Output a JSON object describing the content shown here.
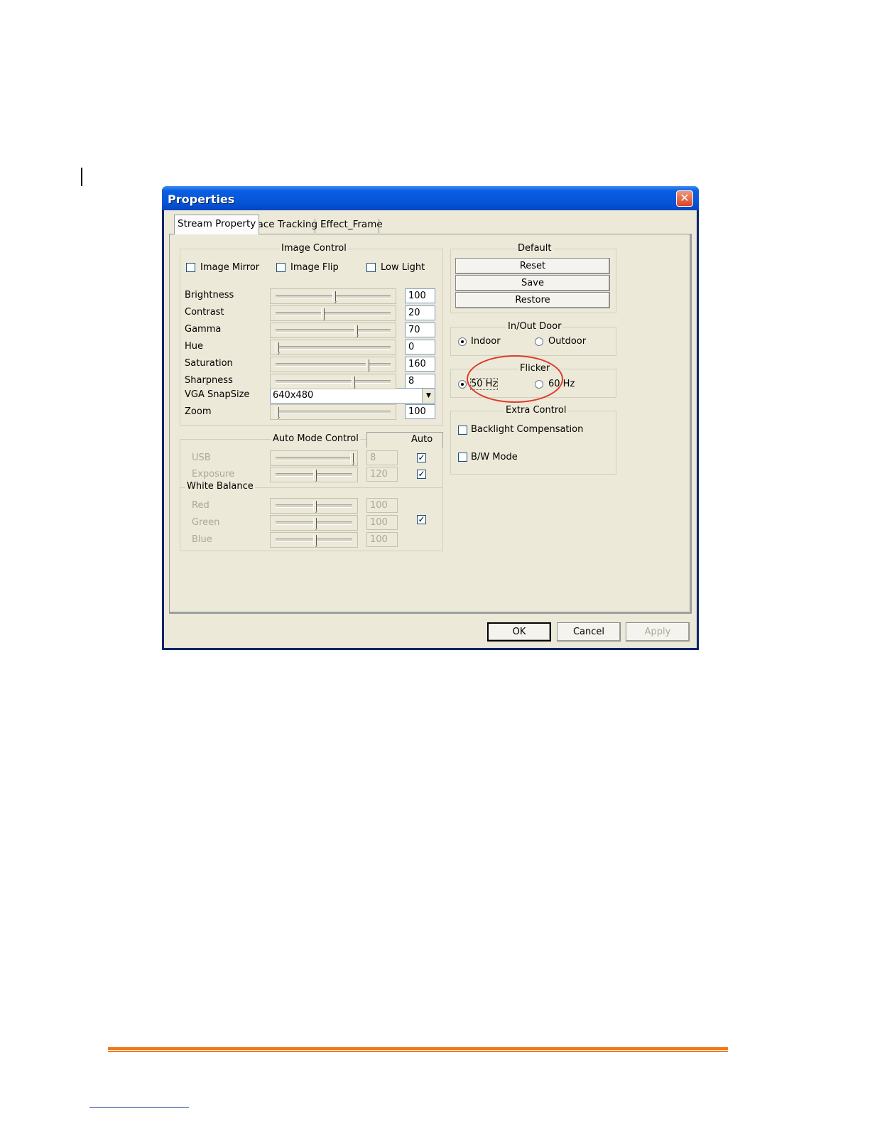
{
  "window": {
    "title": "Properties"
  },
  "tabs": [
    {
      "label": "Stream Property",
      "active": true
    },
    {
      "label": "Face Tracking",
      "active": false
    },
    {
      "label": "Effect_Frame",
      "active": false
    }
  ],
  "image_control": {
    "title": "Image Control",
    "checkboxes": [
      {
        "label": "Image Mirror",
        "checked": false
      },
      {
        "label": "Image Flip",
        "checked": false
      },
      {
        "label": "Low Light",
        "checked": false
      }
    ],
    "sliders": [
      {
        "label": "Brightness",
        "value": "100",
        "level": 0.5
      },
      {
        "label": "Contrast",
        "value": "20",
        "level": 0.4
      },
      {
        "label": "Gamma",
        "value": "70",
        "level": 0.7
      },
      {
        "label": "Hue",
        "value": "0",
        "level": 0.0
      },
      {
        "label": "Saturation",
        "value": "160",
        "level": 0.8
      },
      {
        "label": "Sharpness",
        "value": "8",
        "level": 0.67
      }
    ],
    "snapsize": {
      "label": "VGA SnapSize",
      "value": "640x480"
    },
    "zoom": {
      "label": "Zoom",
      "value": "100",
      "level": 0.0
    }
  },
  "auto_mode": {
    "title": "Auto Mode Control",
    "auto_label": "Auto",
    "rows": [
      {
        "label": "USB",
        "value": "8",
        "level": 1.0,
        "auto": true
      },
      {
        "label": "Exposure",
        "value": "120",
        "level": 0.5,
        "auto": true
      }
    ],
    "white_balance": {
      "title": "White Balance",
      "auto": true,
      "rows": [
        {
          "label": "Red",
          "value": "100",
          "level": 0.5
        },
        {
          "label": "Green",
          "value": "100",
          "level": 0.5
        },
        {
          "label": "Blue",
          "value": "100",
          "level": 0.5
        }
      ]
    }
  },
  "default_group": {
    "title": "Default",
    "buttons": [
      "Reset",
      "Save",
      "Restore"
    ]
  },
  "inout": {
    "title": "In/Out Door",
    "options": [
      {
        "label": "Indoor",
        "selected": true
      },
      {
        "label": "Outdoor",
        "selected": false
      }
    ]
  },
  "flicker": {
    "title": "Flicker",
    "options": [
      {
        "label": "50 Hz",
        "selected": true
      },
      {
        "label": "60 Hz",
        "selected": false
      }
    ],
    "highlight_color": "#e03a2c"
  },
  "extra_control": {
    "title": "Extra Control",
    "checkboxes": [
      {
        "label": "Backlight Compensation",
        "checked": false
      },
      {
        "label": "B/W Mode",
        "checked": false
      }
    ]
  },
  "footer": {
    "ok": "OK",
    "cancel": "Cancel",
    "apply": "Apply"
  },
  "colors": {
    "titlebar": "#0554d8",
    "dialog_bg": "#ece9d8",
    "page_rule": "#f07a1a"
  }
}
